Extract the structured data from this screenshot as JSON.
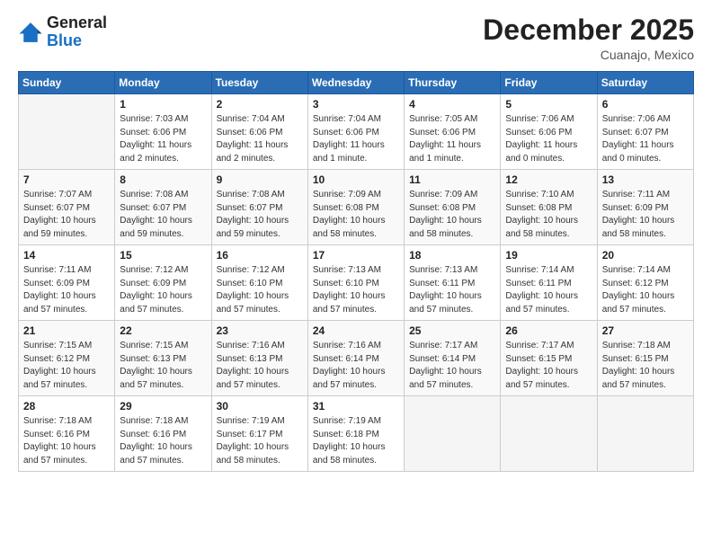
{
  "header": {
    "logo_general": "General",
    "logo_blue": "Blue",
    "month": "December 2025",
    "location": "Cuanajo, Mexico"
  },
  "days_of_week": [
    "Sunday",
    "Monday",
    "Tuesday",
    "Wednesday",
    "Thursday",
    "Friday",
    "Saturday"
  ],
  "weeks": [
    [
      {
        "day": "",
        "sunrise": "",
        "sunset": "",
        "daylight": ""
      },
      {
        "day": "1",
        "sunrise": "Sunrise: 7:03 AM",
        "sunset": "Sunset: 6:06 PM",
        "daylight": "Daylight: 11 hours and 2 minutes."
      },
      {
        "day": "2",
        "sunrise": "Sunrise: 7:04 AM",
        "sunset": "Sunset: 6:06 PM",
        "daylight": "Daylight: 11 hours and 2 minutes."
      },
      {
        "day": "3",
        "sunrise": "Sunrise: 7:04 AM",
        "sunset": "Sunset: 6:06 PM",
        "daylight": "Daylight: 11 hours and 1 minute."
      },
      {
        "day": "4",
        "sunrise": "Sunrise: 7:05 AM",
        "sunset": "Sunset: 6:06 PM",
        "daylight": "Daylight: 11 hours and 1 minute."
      },
      {
        "day": "5",
        "sunrise": "Sunrise: 7:06 AM",
        "sunset": "Sunset: 6:06 PM",
        "daylight": "Daylight: 11 hours and 0 minutes."
      },
      {
        "day": "6",
        "sunrise": "Sunrise: 7:06 AM",
        "sunset": "Sunset: 6:07 PM",
        "daylight": "Daylight: 11 hours and 0 minutes."
      }
    ],
    [
      {
        "day": "7",
        "sunrise": "Sunrise: 7:07 AM",
        "sunset": "Sunset: 6:07 PM",
        "daylight": "Daylight: 10 hours and 59 minutes."
      },
      {
        "day": "8",
        "sunrise": "Sunrise: 7:08 AM",
        "sunset": "Sunset: 6:07 PM",
        "daylight": "Daylight: 10 hours and 59 minutes."
      },
      {
        "day": "9",
        "sunrise": "Sunrise: 7:08 AM",
        "sunset": "Sunset: 6:07 PM",
        "daylight": "Daylight: 10 hours and 59 minutes."
      },
      {
        "day": "10",
        "sunrise": "Sunrise: 7:09 AM",
        "sunset": "Sunset: 6:08 PM",
        "daylight": "Daylight: 10 hours and 58 minutes."
      },
      {
        "day": "11",
        "sunrise": "Sunrise: 7:09 AM",
        "sunset": "Sunset: 6:08 PM",
        "daylight": "Daylight: 10 hours and 58 minutes."
      },
      {
        "day": "12",
        "sunrise": "Sunrise: 7:10 AM",
        "sunset": "Sunset: 6:08 PM",
        "daylight": "Daylight: 10 hours and 58 minutes."
      },
      {
        "day": "13",
        "sunrise": "Sunrise: 7:11 AM",
        "sunset": "Sunset: 6:09 PM",
        "daylight": "Daylight: 10 hours and 58 minutes."
      }
    ],
    [
      {
        "day": "14",
        "sunrise": "Sunrise: 7:11 AM",
        "sunset": "Sunset: 6:09 PM",
        "daylight": "Daylight: 10 hours and 57 minutes."
      },
      {
        "day": "15",
        "sunrise": "Sunrise: 7:12 AM",
        "sunset": "Sunset: 6:09 PM",
        "daylight": "Daylight: 10 hours and 57 minutes."
      },
      {
        "day": "16",
        "sunrise": "Sunrise: 7:12 AM",
        "sunset": "Sunset: 6:10 PM",
        "daylight": "Daylight: 10 hours and 57 minutes."
      },
      {
        "day": "17",
        "sunrise": "Sunrise: 7:13 AM",
        "sunset": "Sunset: 6:10 PM",
        "daylight": "Daylight: 10 hours and 57 minutes."
      },
      {
        "day": "18",
        "sunrise": "Sunrise: 7:13 AM",
        "sunset": "Sunset: 6:11 PM",
        "daylight": "Daylight: 10 hours and 57 minutes."
      },
      {
        "day": "19",
        "sunrise": "Sunrise: 7:14 AM",
        "sunset": "Sunset: 6:11 PM",
        "daylight": "Daylight: 10 hours and 57 minutes."
      },
      {
        "day": "20",
        "sunrise": "Sunrise: 7:14 AM",
        "sunset": "Sunset: 6:12 PM",
        "daylight": "Daylight: 10 hours and 57 minutes."
      }
    ],
    [
      {
        "day": "21",
        "sunrise": "Sunrise: 7:15 AM",
        "sunset": "Sunset: 6:12 PM",
        "daylight": "Daylight: 10 hours and 57 minutes."
      },
      {
        "day": "22",
        "sunrise": "Sunrise: 7:15 AM",
        "sunset": "Sunset: 6:13 PM",
        "daylight": "Daylight: 10 hours and 57 minutes."
      },
      {
        "day": "23",
        "sunrise": "Sunrise: 7:16 AM",
        "sunset": "Sunset: 6:13 PM",
        "daylight": "Daylight: 10 hours and 57 minutes."
      },
      {
        "day": "24",
        "sunrise": "Sunrise: 7:16 AM",
        "sunset": "Sunset: 6:14 PM",
        "daylight": "Daylight: 10 hours and 57 minutes."
      },
      {
        "day": "25",
        "sunrise": "Sunrise: 7:17 AM",
        "sunset": "Sunset: 6:14 PM",
        "daylight": "Daylight: 10 hours and 57 minutes."
      },
      {
        "day": "26",
        "sunrise": "Sunrise: 7:17 AM",
        "sunset": "Sunset: 6:15 PM",
        "daylight": "Daylight: 10 hours and 57 minutes."
      },
      {
        "day": "27",
        "sunrise": "Sunrise: 7:18 AM",
        "sunset": "Sunset: 6:15 PM",
        "daylight": "Daylight: 10 hours and 57 minutes."
      }
    ],
    [
      {
        "day": "28",
        "sunrise": "Sunrise: 7:18 AM",
        "sunset": "Sunset: 6:16 PM",
        "daylight": "Daylight: 10 hours and 57 minutes."
      },
      {
        "day": "29",
        "sunrise": "Sunrise: 7:18 AM",
        "sunset": "Sunset: 6:16 PM",
        "daylight": "Daylight: 10 hours and 57 minutes."
      },
      {
        "day": "30",
        "sunrise": "Sunrise: 7:19 AM",
        "sunset": "Sunset: 6:17 PM",
        "daylight": "Daylight: 10 hours and 58 minutes."
      },
      {
        "day": "31",
        "sunrise": "Sunrise: 7:19 AM",
        "sunset": "Sunset: 6:18 PM",
        "daylight": "Daylight: 10 hours and 58 minutes."
      },
      {
        "day": "",
        "sunrise": "",
        "sunset": "",
        "daylight": ""
      },
      {
        "day": "",
        "sunrise": "",
        "sunset": "",
        "daylight": ""
      },
      {
        "day": "",
        "sunrise": "",
        "sunset": "",
        "daylight": ""
      }
    ]
  ]
}
